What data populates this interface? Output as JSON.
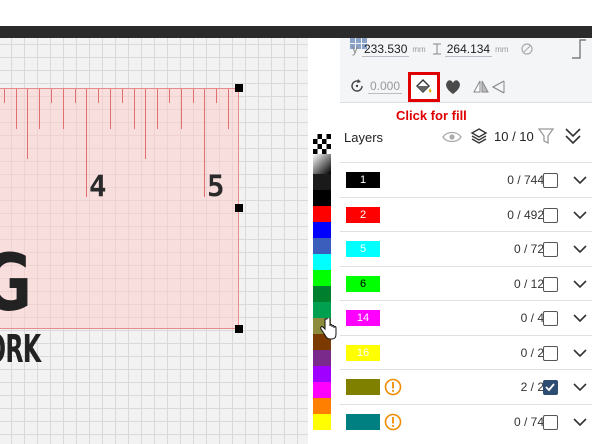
{
  "canvas": {
    "ruler_numbers": [
      "4",
      "5"
    ],
    "text_large": "G",
    "text_small": "ORK"
  },
  "palette": {
    "colors": [
      "#1a1a1a",
      "#000000",
      "#ff0000",
      "#0000ff",
      "#3b5dbc",
      "#00ffff",
      "#00ff00",
      "#007f2f",
      "#00a050",
      "#8c8c3c",
      "#7a3a00",
      "#7a2a8a",
      "#a000ff",
      "#ff00ff",
      "#ff8000",
      "#ffff00"
    ]
  },
  "panel": {
    "y_label": "y",
    "y_value": "233.530",
    "x_label": "",
    "height_value": "264.134",
    "unit": "mm",
    "rotate_value": "0.000",
    "annotation": "Click for fill"
  },
  "layers": {
    "title": "Layers",
    "count": "10 / 10",
    "rows": [
      {
        "label": "1",
        "color": "#000000",
        "text_color": "#ffffff",
        "count": "0 / 744",
        "checked": false,
        "warning": false
      },
      {
        "label": "2",
        "color": "#ff0000",
        "text_color": "#ffffff",
        "count": "0 / 492",
        "checked": false,
        "warning": false
      },
      {
        "label": "5",
        "color": "#00ffff",
        "text_color": "#ffffff",
        "count": "0 / 72",
        "checked": false,
        "warning": false
      },
      {
        "label": "6",
        "color": "#00ff00",
        "text_color": "#000000",
        "count": "0 / 12",
        "checked": false,
        "warning": false
      },
      {
        "label": "14",
        "color": "#ff00ff",
        "text_color": "#ffffff",
        "count": "0 / 4",
        "checked": false,
        "warning": false
      },
      {
        "label": "16",
        "color": "#ffff00",
        "text_color": "#ffffff",
        "count": "0 / 2",
        "checked": false,
        "warning": false
      },
      {
        "label": "",
        "color": "#808000",
        "text_color": "#ffffff",
        "count": "2 / 2",
        "checked": true,
        "warning": true
      },
      {
        "label": "",
        "color": "#008080",
        "text_color": "#ffffff",
        "count": "0 / 74",
        "checked": false,
        "warning": true
      }
    ]
  },
  "colors": {
    "accent_red": "#e00000",
    "check_blue": "#2c4d71",
    "warning_orange": "#f08c00"
  }
}
